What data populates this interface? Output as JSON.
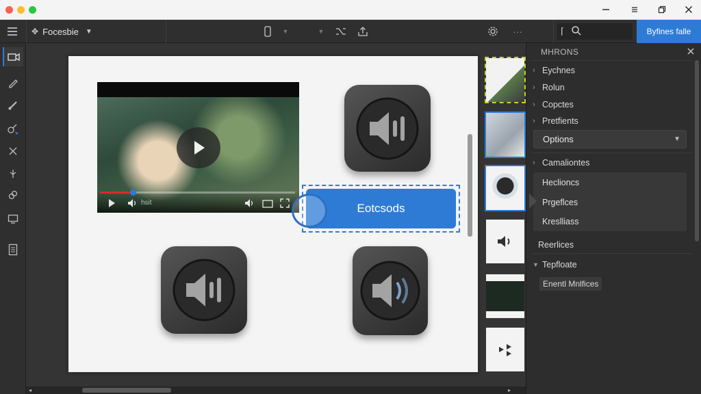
{
  "window": {
    "traffic_lights": [
      "#ff5f57",
      "#febc2e",
      "#28c840"
    ],
    "controls": [
      "minimize-icon",
      "maximize-icon",
      "restore-icon",
      "close-icon"
    ]
  },
  "toolbar": {
    "project_name": "Focesbie",
    "primary_button": "Byfines falle"
  },
  "canvas": {
    "video_progress": 0.17,
    "video_label": "hsit",
    "selected_button_label": "Eotcsods"
  },
  "panel": {
    "title": "MHRONS",
    "items": [
      "Eychnes",
      "Rolun",
      "Copctes",
      "Pretfients"
    ],
    "dropdown_value": "Options",
    "group_label": "Camaliontes",
    "sub_items": [
      "Heclioncs",
      "Prgeflces",
      "Kreslliass"
    ],
    "row_after": "Reerlices",
    "expanded_label": "Tepfloate",
    "expanded_child": "Enentl Mnlfices"
  },
  "colors": {
    "accent": "#2e7bd6",
    "panel_bg": "#2d2d2d",
    "toolbar_bg": "#2f2f2f",
    "canvas_page": "#f4f4f4"
  }
}
